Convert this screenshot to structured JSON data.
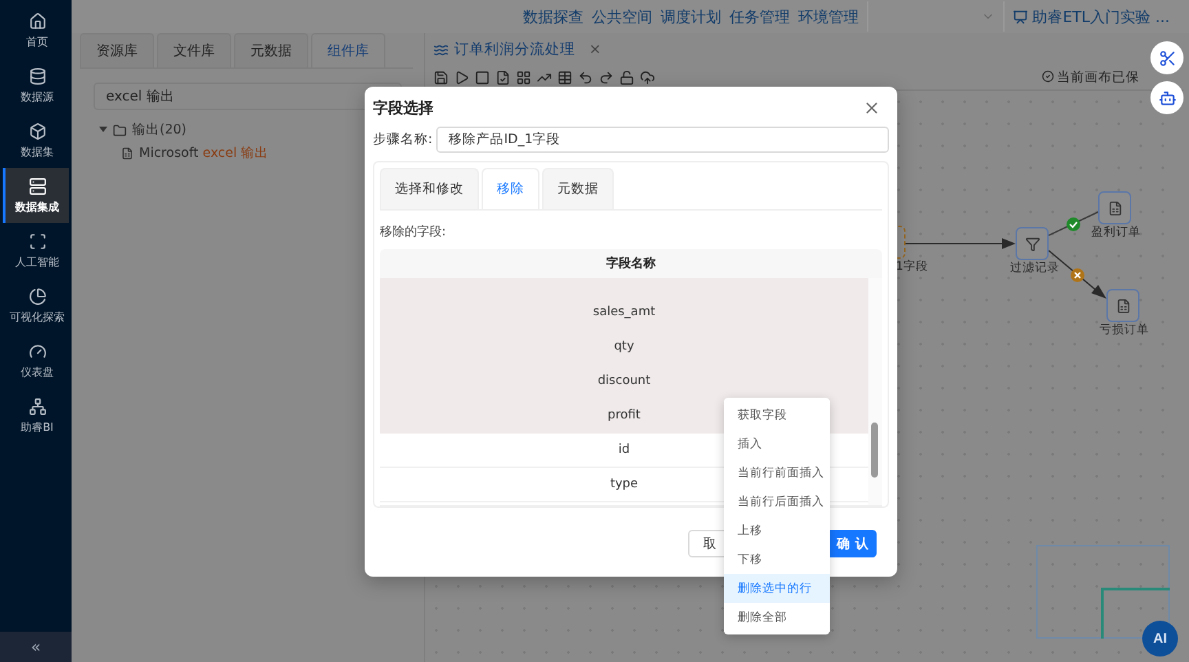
{
  "sidebar": {
    "items": [
      {
        "label": "首页",
        "selected": false
      },
      {
        "label": "数据源",
        "selected": false
      },
      {
        "label": "数据集",
        "selected": false
      },
      {
        "label": "数据集成",
        "selected": true
      },
      {
        "label": "人工智能",
        "selected": false
      },
      {
        "label": "可视化探索",
        "selected": false
      },
      {
        "label": "仪表盘",
        "selected": false
      },
      {
        "label": "助睿BI",
        "selected": false
      }
    ],
    "collapse": "«"
  },
  "top_nav": {
    "links": [
      "数据探查",
      "公共空间",
      "调度计划",
      "任务管理",
      "环境管理"
    ],
    "project": "助睿ETL入门实验 ..."
  },
  "left_panel": {
    "tabs": [
      {
        "label": "资源库",
        "selected": false
      },
      {
        "label": "文件库",
        "selected": false
      },
      {
        "label": "元数据",
        "selected": false
      },
      {
        "label": "组件库",
        "selected": true
      }
    ],
    "search": {
      "value": "excel 输出"
    },
    "tree": [
      {
        "label": "输出(20)",
        "expanded": true,
        "children": [
          {
            "label": "Microsoft **excel 输出**"
          }
        ]
      }
    ]
  },
  "canvas": {
    "tab": {
      "title": "订单利润分流处理",
      "close": "×"
    },
    "status": "当前画布已保",
    "nodes": [
      {
        "label": "1字段",
        "kind": "partial"
      },
      {
        "label": "过滤记录",
        "kind": "filter"
      },
      {
        "label": "盈利订单",
        "kind": "excel"
      },
      {
        "label": "亏损订单",
        "kind": "excel"
      }
    ],
    "ai_button": "AI"
  },
  "dialog": {
    "title": "字段选择",
    "step_label": "步骤名称:",
    "step_value": "移除产品ID_1字段",
    "tabs": [
      {
        "label": "选择和修改",
        "selected": false
      },
      {
        "label": "移除",
        "selected": true
      },
      {
        "label": "元数据",
        "selected": false
      }
    ],
    "fields_label": "移除的字段:",
    "column": "字段名称",
    "rows": [
      {
        "name": "sales_amt",
        "selected": true
      },
      {
        "name": "qty",
        "selected": true
      },
      {
        "name": "discount",
        "selected": true
      },
      {
        "name": "profit",
        "selected": true
      },
      {
        "name": "id",
        "selected": false
      },
      {
        "name": "type",
        "selected": false
      }
    ],
    "buttons": [
      {
        "label": "取",
        "kind": "cancel"
      },
      {
        "label": "确 认",
        "kind": "primary"
      }
    ]
  },
  "context_menu": [
    {
      "label": "获取字段",
      "selected": false
    },
    {
      "label": "插入",
      "selected": false
    },
    {
      "label": "当前行前面插入",
      "selected": false
    },
    {
      "label": "当前行后面插入",
      "selected": false
    },
    {
      "label": "上移",
      "selected": false
    },
    {
      "label": "下移",
      "selected": false
    },
    {
      "label": "删除选中的行",
      "selected": true
    },
    {
      "label": "删除全部",
      "selected": false
    }
  ]
}
